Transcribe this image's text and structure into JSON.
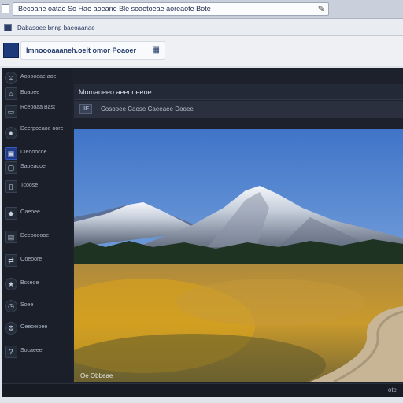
{
  "browser": {
    "address_text": "Becoane oatae So Hae aoeane Ble soaetoeae aoreaote Bote",
    "address_icon": "edit-icon",
    "bookmark_text": "Dabasoee bnnp baeoaanae"
  },
  "app": {
    "header_text": "lmnoooaaaneh.oeit omor Poaoer",
    "header_icon": "image-icon",
    "content_title": "Momaoeeo aeeooeeoe",
    "content_bar_icon": "IIF",
    "content_bar_text": "Cosooee Caose Caeeaee Dooee",
    "photo_caption": "Oe Obbeae",
    "status_right": "ote"
  },
  "sidebar": {
    "items": [
      {
        "label": "Aooooeae aoe",
        "icon": "logo-icon"
      },
      {
        "label": "Boaoee",
        "icon": "home-icon"
      },
      {
        "label": "Rceooaa Bast",
        "icon": "folder-icon"
      },
      {
        "label": "Deerpoeaoe oore",
        "icon": "user-icon"
      },
      {
        "label": "Dleooocoe",
        "icon": "image-icon"
      },
      {
        "label": "Saoeaooe",
        "icon": "album-icon"
      },
      {
        "label": "Tcoose",
        "icon": "document-icon"
      },
      {
        "label": "Oaeoee",
        "icon": "tag-icon"
      },
      {
        "label": "Deeoooooe",
        "icon": "calendar-icon"
      },
      {
        "label": "Ooeoore",
        "icon": "share-icon"
      },
      {
        "label": "Bcceoe",
        "icon": "star-icon"
      },
      {
        "label": "Soee",
        "icon": "clock-icon"
      },
      {
        "label": "Oeeoeioee",
        "icon": "settings-icon"
      },
      {
        "label": "Socaeeer",
        "icon": "help-icon"
      }
    ]
  },
  "colors": {
    "app_background": "#1c212c",
    "accent": "#1f3b8a",
    "sky": "#5a89cf"
  }
}
